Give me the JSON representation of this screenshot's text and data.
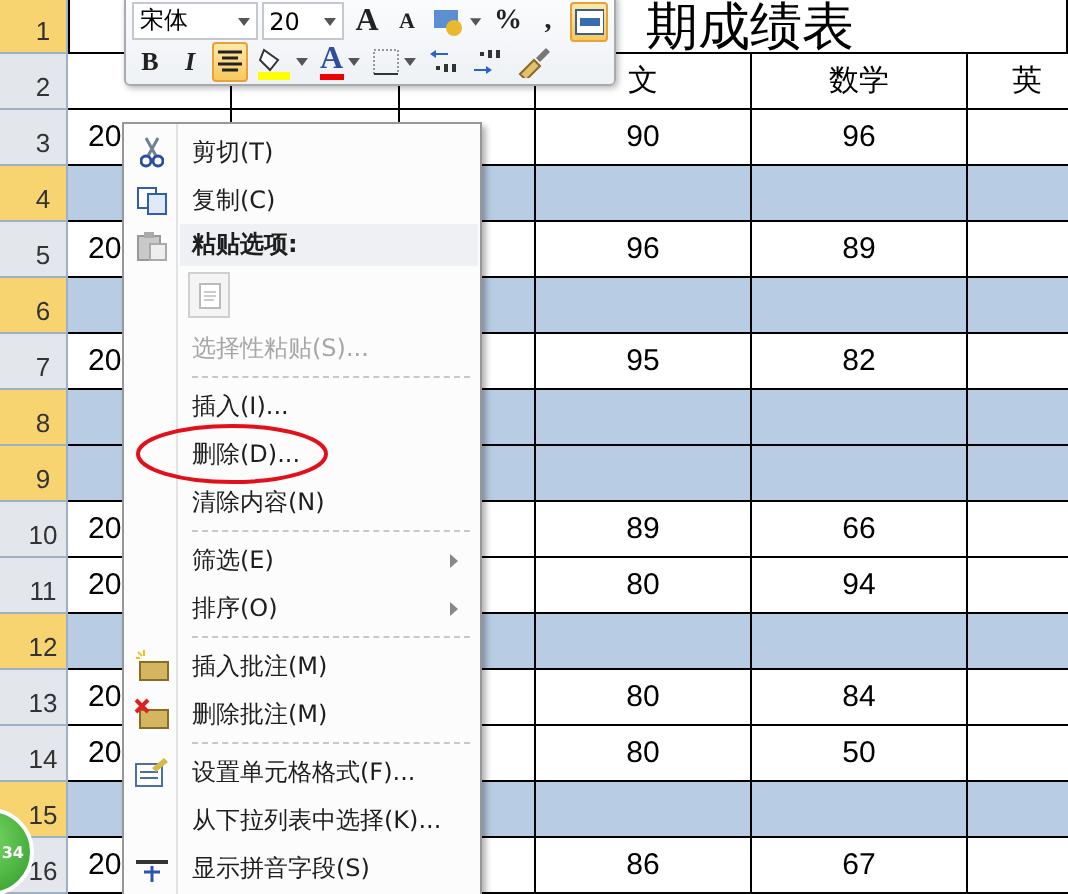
{
  "mini_toolbar": {
    "rows": [
      [
        {
          "kind": "font-field",
          "value": "宋体"
        },
        {
          "kind": "size-field",
          "value": "20"
        },
        {
          "kind": "grow-font",
          "label": "A"
        },
        {
          "kind": "shrink-font",
          "label": "A"
        },
        {
          "kind": "accounting"
        },
        {
          "kind": "glyph",
          "label": "%"
        },
        {
          "kind": "glyph",
          "label": ","
        },
        {
          "kind": "merge",
          "selected": true
        }
      ],
      [
        {
          "kind": "bold",
          "label": "B",
          "selected": false
        },
        {
          "kind": "italic",
          "label": "I",
          "selected": false
        },
        {
          "kind": "align-center",
          "selected": true
        },
        {
          "kind": "fill-color"
        },
        {
          "kind": "font-color",
          "label": "A"
        },
        {
          "kind": "borders"
        },
        {
          "kind": "decrease-decimal"
        },
        {
          "kind": "increase-decimal"
        },
        {
          "kind": "format-painter"
        }
      ]
    ]
  },
  "sheet": {
    "title": "期成绩表",
    "rows": [
      {
        "header": "1",
        "header_highlighted": true,
        "selected": false
      },
      {
        "header": "2",
        "header_highlighted": false,
        "selected": false,
        "values": {
          "column_4": "文",
          "column_5": "数学",
          "column_6": "英"
        }
      },
      {
        "header": "3",
        "header_highlighted": false,
        "selected": false,
        "values": {
          "column_1": "20",
          "column_4": "90",
          "column_5": "96"
        }
      },
      {
        "header": "4",
        "header_highlighted": true,
        "selected": true
      },
      {
        "header": "5",
        "header_highlighted": false,
        "selected": false,
        "values": {
          "column_1": "20",
          "column_4": "96",
          "column_5": "89"
        }
      },
      {
        "header": "6",
        "header_highlighted": true,
        "selected": true
      },
      {
        "header": "7",
        "header_highlighted": false,
        "selected": false,
        "values": {
          "column_1": "20",
          "column_4": "95",
          "column_5": "82"
        }
      },
      {
        "header": "8",
        "header_highlighted": true,
        "selected": true
      },
      {
        "header": "9",
        "header_highlighted": true,
        "selected": true
      },
      {
        "header": "10",
        "header_highlighted": false,
        "selected": false,
        "values": {
          "column_1": "20",
          "column_4": "89",
          "column_5": "66"
        }
      },
      {
        "header": "11",
        "header_highlighted": false,
        "selected": false,
        "values": {
          "column_1": "20",
          "column_4": "80",
          "column_5": "94"
        }
      },
      {
        "header": "12",
        "header_highlighted": true,
        "selected": true
      },
      {
        "header": "13",
        "header_highlighted": false,
        "selected": false,
        "values": {
          "column_1": "20",
          "column_4": "80",
          "column_5": "84"
        }
      },
      {
        "header": "14",
        "header_highlighted": false,
        "selected": false,
        "values": {
          "column_1": "20",
          "column_4": "80",
          "column_5": "50"
        }
      },
      {
        "header": "15",
        "header_highlighted": true,
        "selected": true
      },
      {
        "header": "16",
        "header_highlighted": false,
        "selected": false,
        "values": {
          "column_1": "20",
          "column_4": "86",
          "column_5": "67"
        }
      }
    ]
  },
  "context_menu": {
    "items": [
      {
        "kind": "command",
        "label": "剪切(T)",
        "disabled": false,
        "submenu": false,
        "circled": false
      },
      {
        "kind": "command",
        "label": "复制(C)",
        "disabled": false,
        "submenu": false,
        "circled": false
      },
      {
        "kind": "header",
        "label": "粘贴选项:"
      },
      {
        "kind": "paste-option"
      },
      {
        "kind": "command",
        "label": "选择性粘贴(S)...",
        "disabled": true,
        "submenu": false,
        "circled": false
      },
      {
        "kind": "separator"
      },
      {
        "kind": "command",
        "label": "插入(I)...",
        "disabled": false,
        "submenu": false,
        "circled": false
      },
      {
        "kind": "command",
        "label": "删除(D)...",
        "disabled": false,
        "submenu": false,
        "circled": true
      },
      {
        "kind": "command",
        "label": "清除内容(N)",
        "disabled": false,
        "submenu": false,
        "circled": false
      },
      {
        "kind": "separator"
      },
      {
        "kind": "command",
        "label": "筛选(E)",
        "disabled": false,
        "submenu": true,
        "circled": false
      },
      {
        "kind": "command",
        "label": "排序(O)",
        "disabled": false,
        "submenu": true,
        "circled": false
      },
      {
        "kind": "separator"
      },
      {
        "kind": "command",
        "label": "插入批注(M)",
        "disabled": false,
        "submenu": false,
        "circled": false
      },
      {
        "kind": "command",
        "label": "删除批注(M)",
        "disabled": false,
        "submenu": false,
        "circled": false
      },
      {
        "kind": "separator"
      },
      {
        "kind": "command",
        "label": "设置单元格格式(F)...",
        "disabled": false,
        "submenu": false,
        "circled": false
      },
      {
        "kind": "command",
        "label": "从下拉列表中选择(K)...",
        "disabled": false,
        "submenu": false,
        "circled": false
      },
      {
        "kind": "command",
        "label": "显示拼音字段(S)",
        "disabled": false,
        "submenu": false,
        "circled": false
      }
    ]
  },
  "badge": {
    "text": "34"
  }
}
